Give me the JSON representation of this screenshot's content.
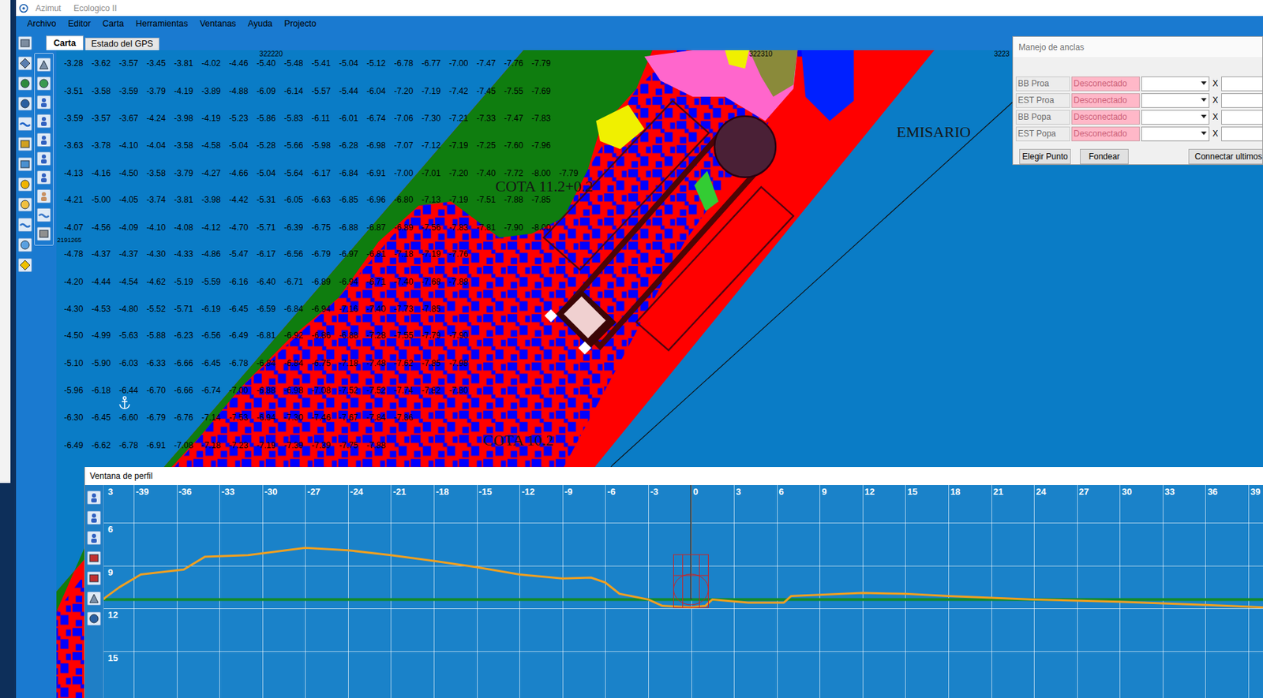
{
  "window": {
    "title": "Azimut",
    "subtitle": "Ecologico II"
  },
  "menu": [
    "Archivo",
    "Editor",
    "Carta",
    "Herramientas",
    "Ventanas",
    "Ayuda",
    "Projecto"
  ],
  "tabs": [
    {
      "label": "Carta",
      "selected": true
    },
    {
      "label": "Estado del GPS",
      "selected": false
    }
  ],
  "map": {
    "easting_labels": [
      "322220",
      "322310",
      "3223"
    ],
    "northing_labels": [
      "2191265"
    ],
    "labels": [
      "COTA 11.2+0.2",
      "COTA 10.2",
      "EMISARIO"
    ],
    "soundings": [
      [
        "-3.28",
        "-3.62",
        "-3.57",
        "-3.45",
        "-3.81",
        "-4.02",
        "-4.46",
        "-5.40",
        "-5.48",
        "-5.41",
        "-5.04",
        "-5.12",
        "-6.78",
        "-6.77",
        "-7.00",
        "-7.47",
        "-7.76",
        "-7.79"
      ],
      [
        "-3.51",
        "-3.58",
        "-3.59",
        "-3.79",
        "-4.19",
        "-3.89",
        "-4.88",
        "-6.09",
        "-6.14",
        "-5.57",
        "-5.44",
        "-6.04",
        "-7.20",
        "-7.19",
        "-7.42",
        "-7.45",
        "-7.55",
        "-7.69"
      ],
      [
        "-3.59",
        "-3.57",
        "-3.67",
        "-4.24",
        "-3.98",
        "-4.19",
        "-5.23",
        "-5.86",
        "-5.83",
        "-6.11",
        "-6.01",
        "-6.74",
        "-7.06",
        "-7.30",
        "-7.21",
        "-7.33",
        "-7.47",
        "-7.83"
      ],
      [
        "-3.63",
        "-3.78",
        "-4.10",
        "-4.04",
        "-3.58",
        "-4.58",
        "-5.04",
        "-5.28",
        "-5.66",
        "-5.98",
        "-6.28",
        "-6.98",
        "-7.07",
        "-7.12",
        "-7.19",
        "-7.25",
        "-7.60",
        "-7.96"
      ],
      [
        "-4.13",
        "-4.16",
        "-4.50",
        "-3.58",
        "-3.79",
        "-4.27",
        "-4.66",
        "-5.04",
        "-5.64",
        "-6.17",
        "-6.84",
        "-6.91",
        "-7.00",
        "-7.01",
        "-7.20",
        "-7.40",
        "-7.72",
        "-8.00",
        "-7.79"
      ],
      [
        "-4.21",
        "-5.00",
        "-4.05",
        "-3.74",
        "-3.81",
        "-3.98",
        "-4.42",
        "-5.31",
        "-6.05",
        "-6.63",
        "-6.85",
        "-6.96",
        "-6.80",
        "-7.13",
        "-7.19",
        "-7.51",
        "-7.88",
        "-7.85"
      ],
      [
        "-4.07",
        "-4.56",
        "-4.09",
        "-4.10",
        "-4.08",
        "-4.12",
        "-4.70",
        "-5.71",
        "-6.39",
        "-6.75",
        "-6.88",
        "-6.87",
        "-6.89",
        "-7.56",
        "-7.83",
        "-7.81",
        "-7.90",
        "-8.00"
      ],
      [
        "-4.78",
        "-4.37",
        "-4.37",
        "-4.30",
        "-4.33",
        "-4.86",
        "-5.47",
        "-6.17",
        "-6.56",
        "-6.79",
        "-6.97",
        "-6.81",
        "-7.18",
        "-7.19",
        "-7.76"
      ],
      [
        "-4.20",
        "-4.44",
        "-4.54",
        "-4.62",
        "-5.19",
        "-5.59",
        "-6.16",
        "-6.40",
        "-6.71",
        "-6.89",
        "-6.94",
        "-6.71",
        "-7.40",
        "-7.68",
        "-7.88"
      ],
      [
        "-4.30",
        "-4.53",
        "-4.80",
        "-5.52",
        "-5.71",
        "-6.19",
        "-6.45",
        "-6.59",
        "-6.84",
        "-6.94",
        "-7.16",
        "-7.40",
        "-7.73",
        "-7.85"
      ],
      [
        "-4.50",
        "-4.99",
        "-5.63",
        "-5.88",
        "-6.23",
        "-6.56",
        "-6.49",
        "-6.81",
        "-6.92",
        "-6.86",
        "-6.88",
        "-7.28",
        "-7.55",
        "-7.79",
        "-7.90"
      ],
      [
        "-5.10",
        "-5.90",
        "-6.03",
        "-6.33",
        "-6.66",
        "-6.45",
        "-6.78",
        "-6.84",
        "-6.84",
        "-6.75",
        "-7.18",
        "-7.48",
        "-7.62",
        "-7.85",
        "-7.98"
      ],
      [
        "-5.96",
        "-6.18",
        "-6.44",
        "-6.70",
        "-6.66",
        "-6.74",
        "-7.00",
        "-6.88",
        "-6.98",
        "-7.08",
        "-7.52",
        "-7.52",
        "-7.74",
        "-7.82",
        "-7.80"
      ],
      [
        "-6.30",
        "-6.45",
        "-6.60",
        "-6.79",
        "-6.76",
        "-7.14",
        "-7.53",
        "-6.94",
        "-7.30",
        "-7.46",
        "-7.67",
        "-7.84",
        "-7.86"
      ],
      [
        "-6.49",
        "-6.62",
        "-6.78",
        "-6.91",
        "-7.08",
        "-7.18",
        "-7.23",
        "-7.19",
        "-7.39",
        "-7.39",
        "-7.75",
        "-7.88"
      ]
    ]
  },
  "anchor_dialog": {
    "title": "Manejo de anclas",
    "rows": [
      {
        "label": "BB Proa",
        "status": "Desconectado",
        "close": "X"
      },
      {
        "label": "EST Proa",
        "status": "Desconectado",
        "close": "X"
      },
      {
        "label": "BB Popa",
        "status": "Desconectado",
        "close": "X"
      },
      {
        "label": "EST Popa",
        "status": "Desconectado",
        "close": "X"
      }
    ],
    "buttons": [
      "Elegir Punto",
      "Fondear",
      "Connectar ultimos"
    ]
  },
  "profile": {
    "title": "Ventana de perfil",
    "x_ticks": [
      "-39",
      "-36",
      "-33",
      "-30",
      "-27",
      "-24",
      "-21",
      "-18",
      "-15",
      "-12",
      "-9",
      "-6",
      "-3",
      "0",
      "3",
      "6",
      "9",
      "12",
      "15",
      "18",
      "21",
      "24",
      "27",
      "30",
      "33",
      "36",
      "39"
    ],
    "y_ticks": [
      "3",
      "6",
      "9",
      "12",
      "15"
    ],
    "series": [
      {
        "color": "#f0a020",
        "x": [
          -41.1,
          -41,
          -40,
          -38.5,
          -36.5,
          -35.5,
          -34,
          -31,
          -27,
          -24,
          -21,
          -18,
          -15,
          -12,
          -9,
          -7,
          -6,
          -5,
          -3,
          -2,
          0,
          1,
          1.5,
          4,
          6.5,
          7,
          12,
          15,
          18,
          24,
          30,
          36,
          40.1
        ],
        "y": [
          11.37,
          11.25,
          10.52,
          9.62,
          9.39,
          9.28,
          8.37,
          8.26,
          7.75,
          7.92,
          8.26,
          8.66,
          9.11,
          9.62,
          9.9,
          9.84,
          10.18,
          10.97,
          11.37,
          11.82,
          11.93,
          11.82,
          11.37,
          11.59,
          11.59,
          11.14,
          10.92,
          10.97,
          11.14,
          11.37,
          11.54,
          11.76,
          11.93
        ]
      },
      {
        "color": "#138a2c",
        "x": [
          -41.1,
          40.1
        ],
        "y": [
          11.37,
          11.37
        ]
      }
    ]
  }
}
